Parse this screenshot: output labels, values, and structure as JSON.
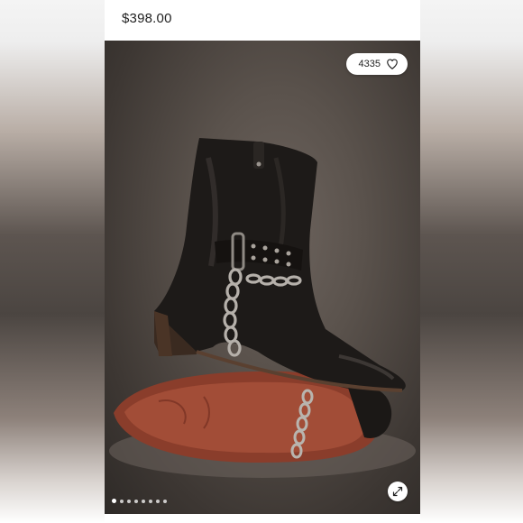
{
  "listing": {
    "price": "$398.00"
  },
  "photo": {
    "like_count": "4335",
    "like_icon": "heart-outline-icon",
    "expand_icon": "expand-arrows-icon",
    "gallery_dots": 8,
    "active_dot": 1
  }
}
